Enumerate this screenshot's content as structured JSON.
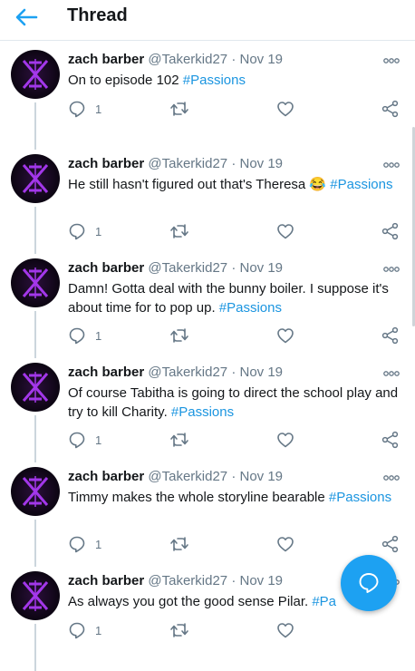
{
  "header": {
    "title": "Thread",
    "back_icon": "arrow-left-icon"
  },
  "colors": {
    "accent": "#1da1f2",
    "hashtag": "#1b95e0",
    "muted": "#657786"
  },
  "tweets": [
    {
      "name": "zach barber",
      "handle": "@Takerkid27",
      "sep": "·",
      "date": "Nov 19",
      "text": "On to episode 102 ",
      "hashtag": "#Passions",
      "replies": "1"
    },
    {
      "name": "zach barber",
      "handle": "@Takerkid27",
      "sep": "·",
      "date": "Nov 19",
      "text": "He still hasn't figured out that's Theresa 😂 ",
      "hashtag": "#Passions",
      "replies": "1"
    },
    {
      "name": "zach barber",
      "handle": "@Takerkid27",
      "sep": "·",
      "date": "Nov 19",
      "text": "Damn! Gotta deal with the bunny boiler. I suppose it's about time for to pop up. ",
      "hashtag": "#Passions",
      "replies": "1"
    },
    {
      "name": "zach barber",
      "handle": "@Takerkid27",
      "sep": "·",
      "date": "Nov 19",
      "text": "Of course Tabitha is going to direct the school play and try to kill Charity. ",
      "hashtag": "#Passions",
      "replies": "1"
    },
    {
      "name": "zach barber",
      "handle": "@Takerkid27",
      "sep": "·",
      "date": "Nov 19",
      "text": "Timmy makes the whole storyline bearable ",
      "hashtag": "#Passions",
      "replies": "1"
    },
    {
      "name": "zach barber",
      "handle": "@Takerkid27",
      "sep": "·",
      "date": "Nov 19",
      "text": "As always you got the good sense Pilar. ",
      "hashtag": "#Pa",
      "replies": "1"
    }
  ],
  "compose_button": {
    "icon": "chat-bubble-icon"
  }
}
